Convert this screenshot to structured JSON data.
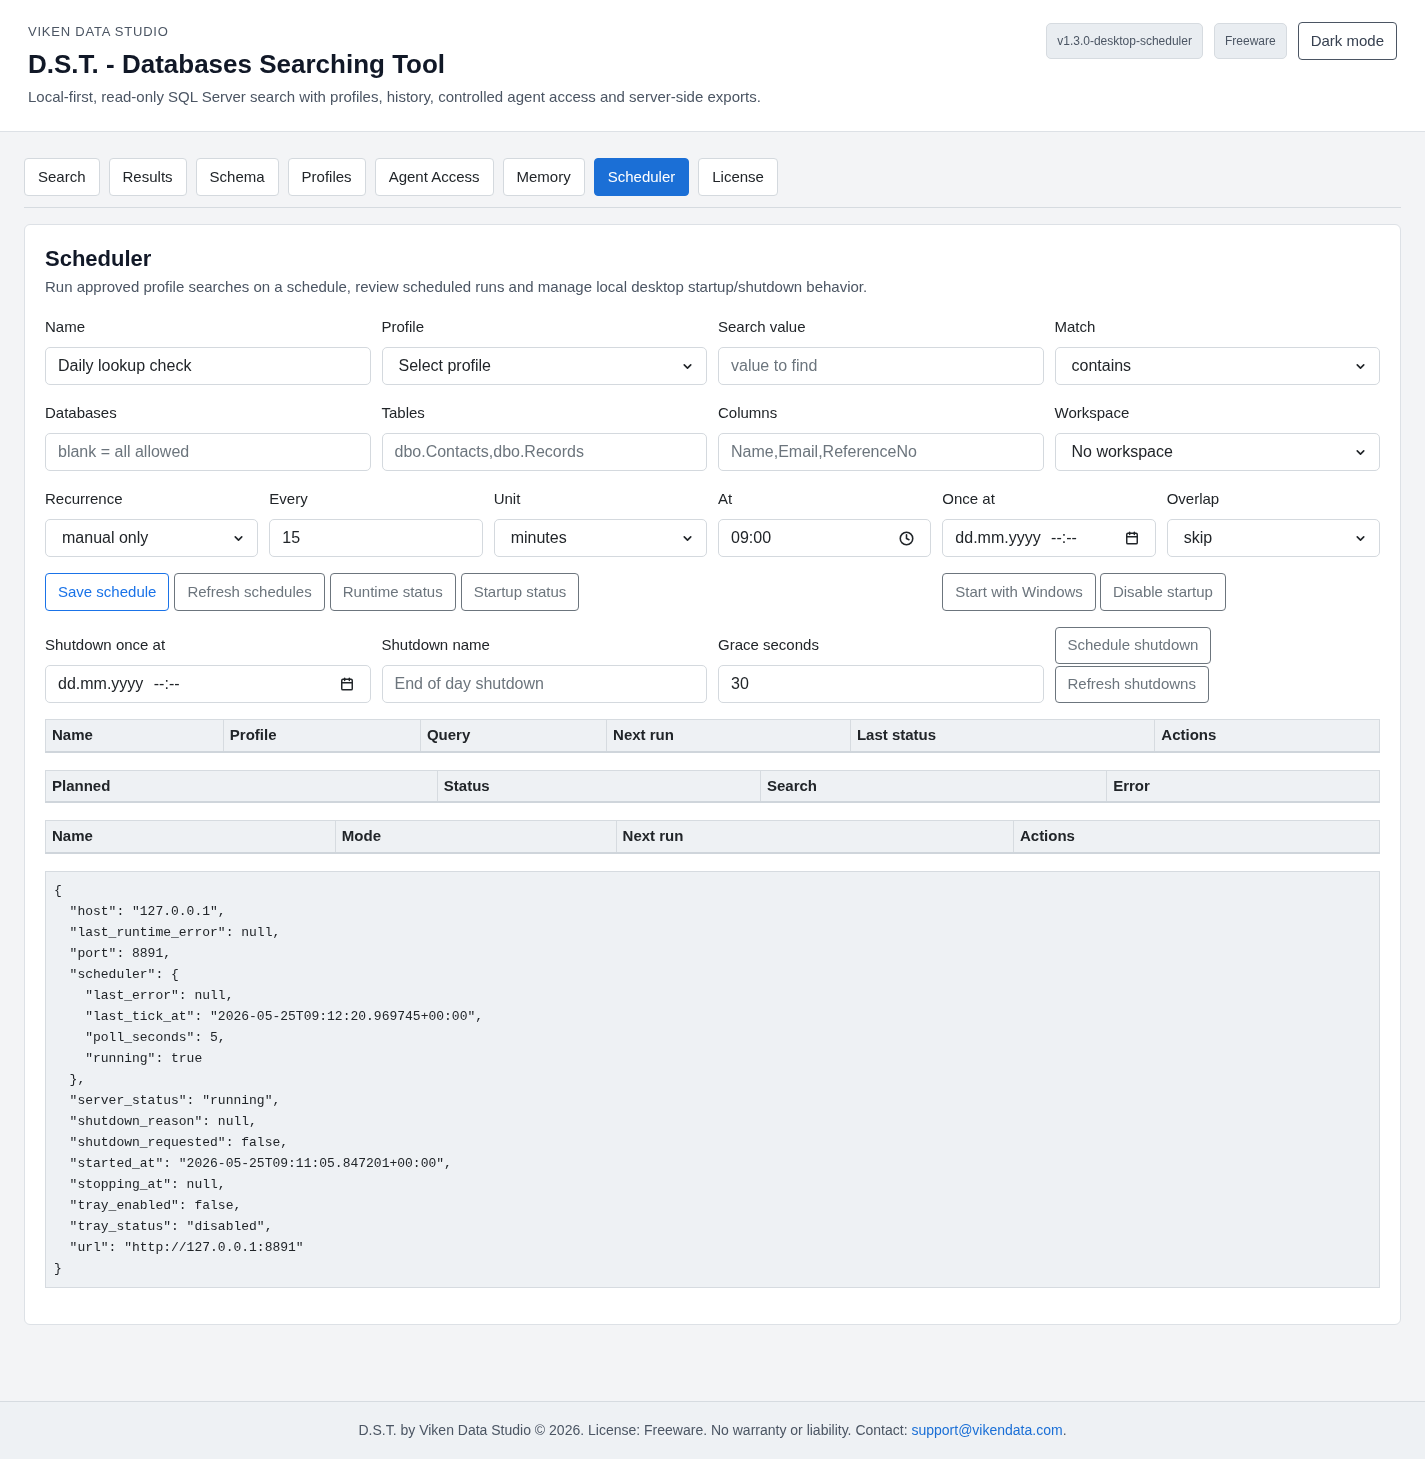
{
  "header": {
    "brand": "VIKEN DATA STUDIO",
    "title": "D.S.T. - Databases Searching Tool",
    "subtitle": "Local-first, read-only SQL Server search with profiles, history, controlled agent access and server-side exports.",
    "badges": [
      "v1.3.0-desktop-scheduler",
      "Freeware"
    ],
    "theme_button": "Dark mode"
  },
  "tabs": [
    {
      "label": "Search",
      "selected": false
    },
    {
      "label": "Results",
      "selected": false
    },
    {
      "label": "Schema",
      "selected": false
    },
    {
      "label": "Profiles",
      "selected": false
    },
    {
      "label": "Agent Access",
      "selected": false
    },
    {
      "label": "Memory",
      "selected": false
    },
    {
      "label": "Scheduler",
      "selected": true
    },
    {
      "label": "License",
      "selected": false
    }
  ],
  "panel": {
    "title": "Scheduler",
    "description": "Run approved profile searches on a schedule, review scheduled runs and manage local desktop startup/shutdown behavior."
  },
  "field_rows": [
    {
      "fields": [
        {
          "label": "Name",
          "kind": "text",
          "value": "Daily lookup check"
        },
        {
          "label": "Profile",
          "kind": "select",
          "value": "Select profile"
        },
        {
          "label": "Search value",
          "kind": "text",
          "placeholder": "value to find"
        },
        {
          "label": "Match",
          "kind": "select",
          "value": "contains"
        }
      ]
    },
    {
      "fields": [
        {
          "label": "Databases",
          "kind": "text",
          "placeholder": "blank = all allowed"
        },
        {
          "label": "Tables",
          "kind": "text",
          "placeholder": "dbo.Contacts,dbo.Records"
        },
        {
          "label": "Columns",
          "kind": "text",
          "placeholder": "Name,Email,ReferenceNo"
        },
        {
          "label": "Workspace",
          "kind": "select",
          "value": "No workspace"
        }
      ]
    },
    {
      "fields": [
        {
          "label": "Recurrence",
          "kind": "select",
          "value": "manual only"
        },
        {
          "label": "Every",
          "kind": "text",
          "value": "15"
        },
        {
          "label": "Unit",
          "kind": "select",
          "value": "minutes"
        },
        {
          "label": "At",
          "kind": "time",
          "value": "09:00"
        },
        {
          "label": "Once at",
          "kind": "datetime",
          "placeholder": "dd.mm.yyyy --:--"
        },
        {
          "label": "Overlap",
          "kind": "select",
          "value": "skip"
        }
      ]
    }
  ],
  "schedule_actions": [
    {
      "label": "Save schedule",
      "kind": "primary"
    },
    {
      "label": "Refresh schedules",
      "kind": "secondary"
    },
    {
      "label": "Runtime status",
      "kind": "secondary"
    },
    {
      "label": "Startup status",
      "kind": "secondary"
    }
  ],
  "startup_actions": [
    {
      "label": "Start with Windows",
      "kind": "secondary"
    },
    {
      "label": "Disable startup",
      "kind": "secondary"
    }
  ],
  "shutdown_fields": [
    {
      "label": "Shutdown once at",
      "kind": "datetime",
      "placeholder": "dd.mm.yyyy --:--"
    },
    {
      "label": "Shutdown name",
      "kind": "text",
      "placeholder": "End of day shutdown"
    },
    {
      "label": "Grace seconds",
      "kind": "text",
      "value": "30"
    }
  ],
  "shutdown_actions": [
    {
      "label": "Schedule shutdown",
      "kind": "secondary"
    },
    {
      "label": "Refresh shutdowns",
      "kind": "secondary"
    }
  ],
  "tables": [
    {
      "columns": [
        "Name",
        "Profile",
        "Query",
        "Next run",
        "Last status",
        "Actions"
      ]
    },
    {
      "columns": [
        "Planned",
        "Status",
        "Search",
        "Error"
      ]
    },
    {
      "columns": [
        "Name",
        "Mode",
        "Next run",
        "Actions"
      ]
    }
  ],
  "runtime_status": {
    "lines": [
      "{",
      "  \"host\": \"127.0.0.1\",",
      "  \"last_runtime_error\": null,",
      "  \"port\": 8891,",
      "  \"scheduler\": {",
      "    \"last_error\": null,",
      "    \"last_tick_at\": \"2026-05-25T09:12:20.969745+00:00\",",
      "    \"poll_seconds\": 5,",
      "    \"running\": true",
      "  },",
      "  \"server_status\": \"running\",",
      "  \"shutdown_reason\": null,",
      "  \"shutdown_requested\": false,",
      "  \"started_at\": \"2026-05-25T09:11:05.847201+00:00\",",
      "  \"stopping_at\": null,",
      "  \"tray_enabled\": false,",
      "  \"tray_status\": \"disabled\",",
      "  \"url\": \"http://127.0.0.1:8891\"",
      "}"
    ]
  },
  "footer": {
    "text": "D.S.T. by Viken Data Studio © 2026. License: Freeware. No warranty or liability. Contact: ",
    "link": "support@vikendata.com",
    "text_after": "."
  }
}
